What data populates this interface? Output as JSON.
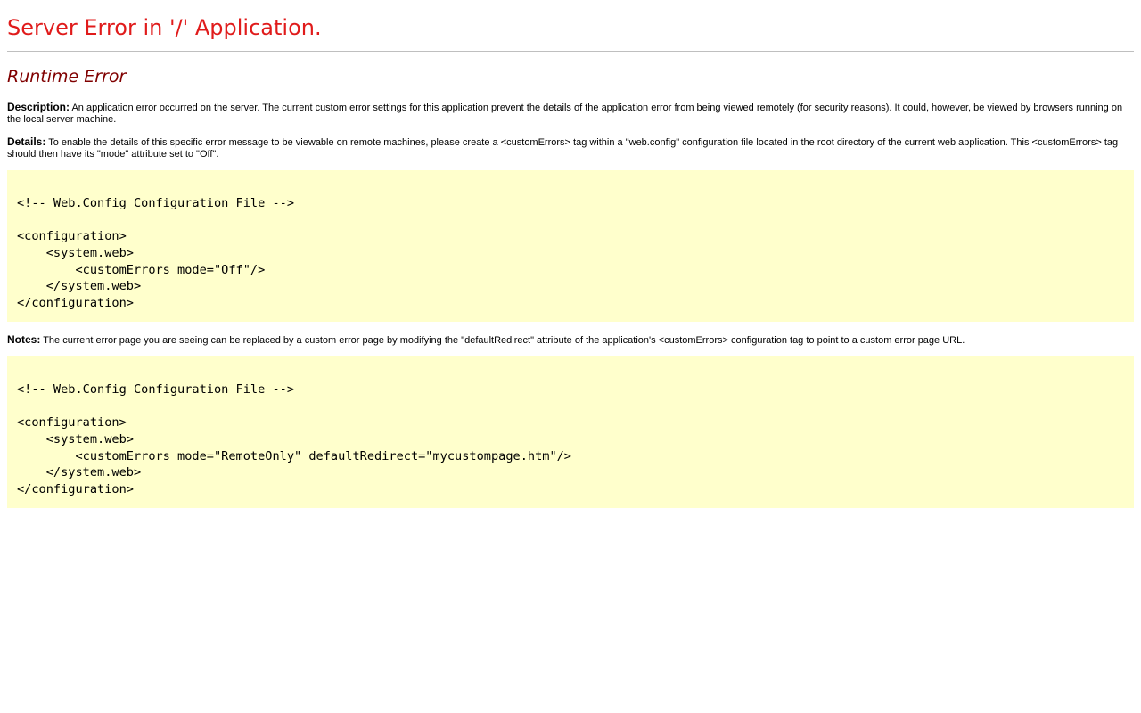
{
  "page": {
    "title": "Server Error in '/' Application.",
    "subtitle": "Runtime Error"
  },
  "description": {
    "label": "Description:",
    "text": " An application error occurred on the server. The current custom error settings for this application prevent the details of the application error from being viewed remotely (for security reasons). It could, however, be viewed by browsers running on the local server machine."
  },
  "details": {
    "label": "Details:",
    "text": " To enable the details of this specific error message to be viewable on remote machines, please create a <customErrors> tag within a \"web.config\" configuration file located in the root directory of the current web application. This <customErrors> tag should then have its \"mode\" attribute set to \"Off\"."
  },
  "code_block_1": {
    "lines": [
      "<!-- Web.Config Configuration File -->",
      "",
      "<configuration>",
      "    <system.web>",
      "        <customErrors mode=\"Off\"/>",
      "    </system.web>",
      "</configuration>"
    ]
  },
  "notes": {
    "label": "Notes:",
    "text": " The current error page you are seeing can be replaced by a custom error page by modifying the \"defaultRedirect\" attribute of the application's <customErrors> configuration tag to point to a custom error page URL."
  },
  "code_block_2": {
    "lines": [
      "<!-- Web.Config Configuration File -->",
      "",
      "<configuration>",
      "    <system.web>",
      "        <customErrors mode=\"RemoteOnly\" defaultRedirect=\"mycustompage.htm\"/>",
      "    </system.web>",
      "</configuration>"
    ]
  },
  "colors": {
    "title": "#e01b1b",
    "subtitle": "#800000",
    "code_background": "#ffffcc",
    "rule": "#bfbfbf"
  }
}
